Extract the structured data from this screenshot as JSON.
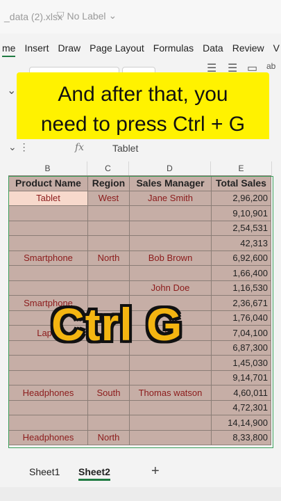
{
  "titlebar": {
    "filename": "_data (2).xlsx",
    "label": "No Label"
  },
  "menu": [
    "me",
    "Insert",
    "Draw",
    "Page Layout",
    "Formulas",
    "Data",
    "Review",
    "V"
  ],
  "overlay": {
    "line1": "And after that, you",
    "line2": "need to press Ctrl + G"
  },
  "formula_bar": {
    "fx": "fx",
    "value": "Tablet"
  },
  "columns": [
    "B",
    "C",
    "D",
    "E"
  ],
  "table": {
    "headers": [
      "Product Name",
      "Region",
      "Sales Manager",
      "Total Sales"
    ],
    "rows": [
      [
        "Tablet",
        "West",
        "Jane Smith",
        "2,96,200"
      ],
      [
        "",
        "",
        "",
        "9,10,901"
      ],
      [
        "",
        "",
        "",
        "2,54,531"
      ],
      [
        "",
        "",
        "",
        "42,313"
      ],
      [
        "Smartphone",
        "North",
        "Bob Brown",
        "6,92,600"
      ],
      [
        "",
        "",
        "",
        "1,66,400"
      ],
      [
        "",
        "",
        "John Doe",
        "1,16,530"
      ],
      [
        "Smartphone",
        "",
        "",
        "2,36,671"
      ],
      [
        "",
        "",
        "",
        "1,76,040"
      ],
      [
        "Lapto",
        "",
        "ice",
        "7,04,100"
      ],
      [
        "",
        "",
        "",
        "6,87,300"
      ],
      [
        "",
        "",
        "",
        "1,45,030"
      ],
      [
        "",
        "",
        "",
        "9,14,701"
      ],
      [
        "Headphones",
        "South",
        "Thomas watson",
        "4,60,011"
      ],
      [
        "",
        "",
        "",
        "4,72,301"
      ],
      [
        "",
        "",
        "",
        "14,14,900"
      ],
      [
        "Headphones",
        "North",
        "",
        "8,33,800"
      ]
    ]
  },
  "big_overlay_text": "Ctrl G",
  "sheets": [
    "Sheet1",
    "Sheet2"
  ],
  "add_sheet": "+"
}
